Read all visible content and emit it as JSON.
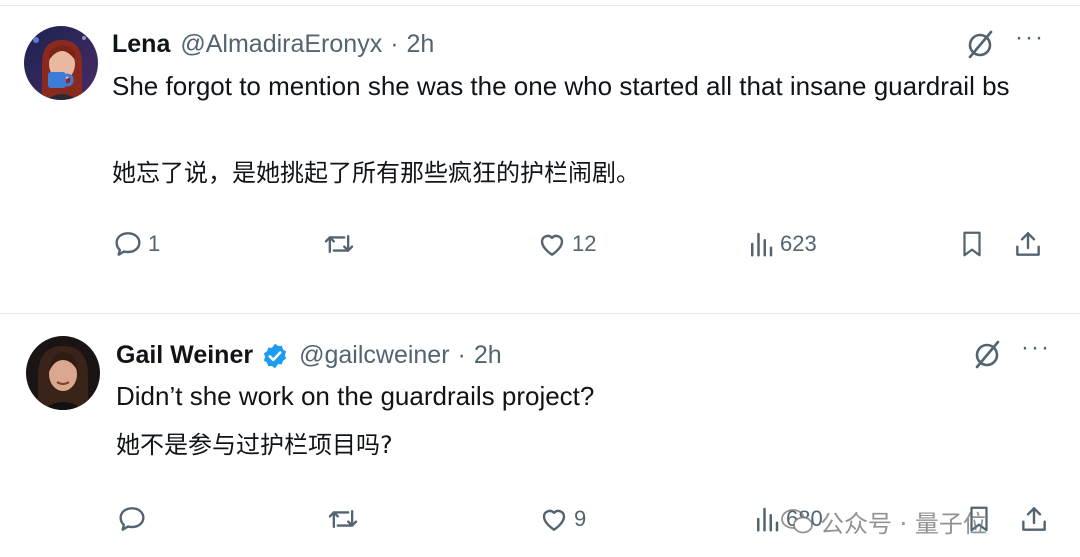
{
  "tweets": [
    {
      "name": "Lena",
      "handle": "@AlmadiraEronyx",
      "dot": "·",
      "time": "2h",
      "text": "She forgot to mention she was the one who started all that insane guardrail bs",
      "translation": "她忘了说，是她挑起了所有那些疯狂的护栏闹剧。",
      "replies": "1",
      "reposts": "",
      "likes": "12",
      "views": "623"
    },
    {
      "name": "Gail Weiner",
      "handle": "@gailcweiner",
      "dot": "·",
      "time": "2h",
      "text": "Didn’t she work on the guardrails project?",
      "translation": "她不是参与过护栏项目吗?",
      "replies": "",
      "reposts": "",
      "likes": "9",
      "views": "680"
    }
  ],
  "more_label": "···",
  "watermark": {
    "text": "公众号 · 量子位"
  },
  "colors": {
    "text": "#0f1419",
    "secondary": "#536471",
    "verified": "#1d9bf0"
  },
  "icons": [
    "reply-icon",
    "repost-icon",
    "like-icon",
    "views-icon",
    "bookmark-icon",
    "share-icon",
    "grok-icon",
    "verified-badge-icon",
    "wechat-icon"
  ]
}
